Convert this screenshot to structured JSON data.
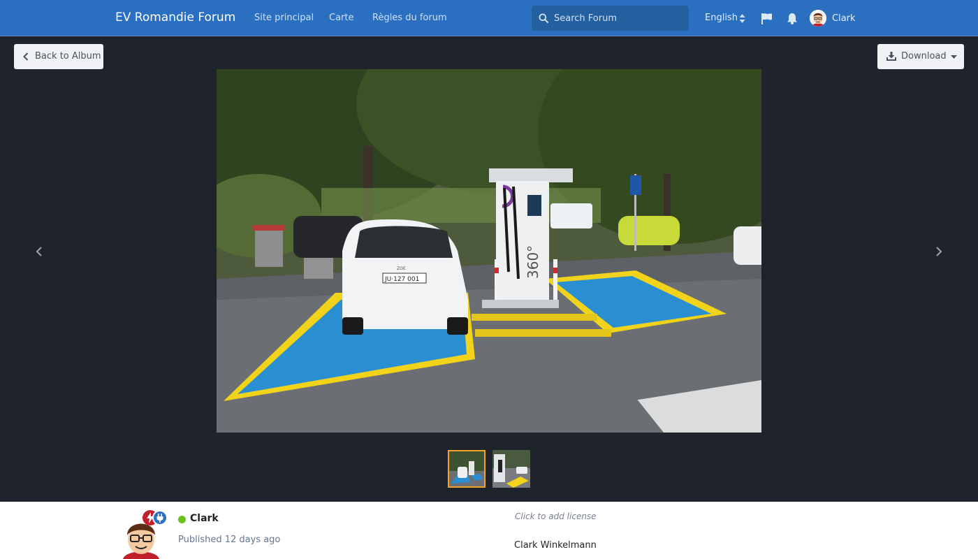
{
  "header": {
    "brand": "EV Romandie Forum",
    "nav": [
      "Site principal",
      "Carte",
      "Règles du forum"
    ],
    "search_placeholder": "Search Forum",
    "language": "English",
    "user_name": "Clark"
  },
  "viewer": {
    "back_label": "Back to Album",
    "download_label": "Download",
    "image_content": {
      "plate": "JU·127 001",
      "car_model_badge": "ZOE",
      "station_text": "360°"
    }
  },
  "info": {
    "author": "Clark",
    "published": "Published 12 days ago",
    "license_prompt": "Click to add license",
    "owner": "Clark Winkelmann"
  },
  "colors": {
    "header_bg": "#2b6fc0",
    "viewer_bg": "#1f232b",
    "active_thumb_border": "#f2a32a",
    "online": "#6bbf1f"
  }
}
